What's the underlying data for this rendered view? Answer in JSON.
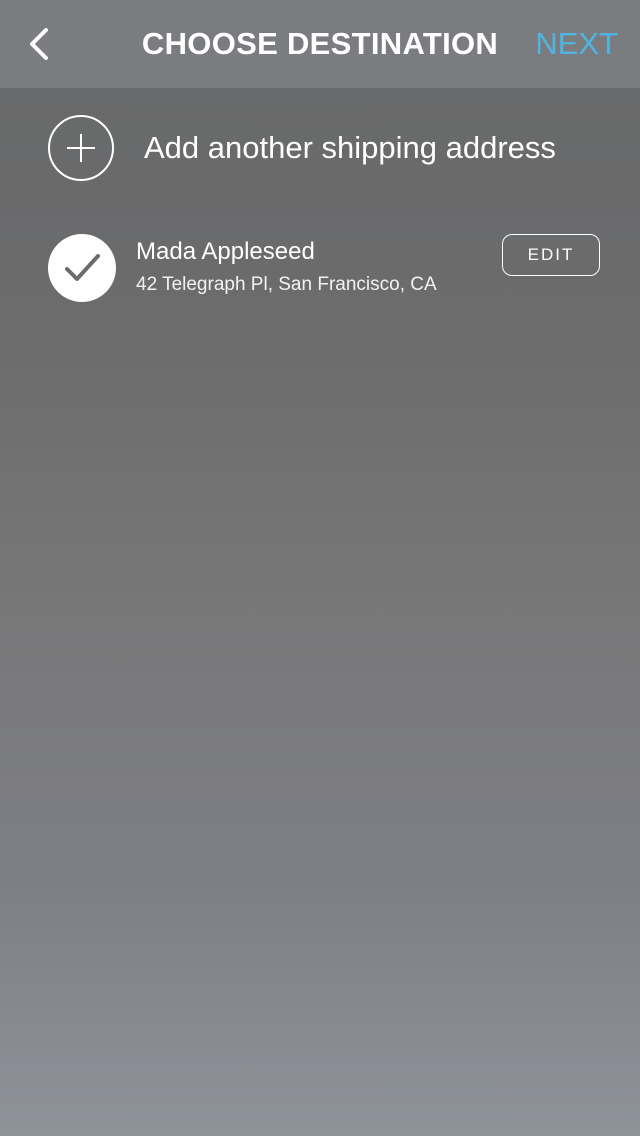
{
  "header": {
    "title": "CHOOSE DESTINATION",
    "next_label": "NEXT",
    "back_icon": "chevron-left-icon"
  },
  "add_address": {
    "label": "Add another shipping address",
    "icon": "plus-circle-icon"
  },
  "addresses": [
    {
      "name": "Mada Appleseed",
      "address": "42 Telegraph Pl, San Francisco, CA",
      "selected": true,
      "edit_label": "EDIT"
    }
  ],
  "colors": {
    "next": "#4fb5e0",
    "navbar": "#7b7c80",
    "text": "#ffffff"
  }
}
